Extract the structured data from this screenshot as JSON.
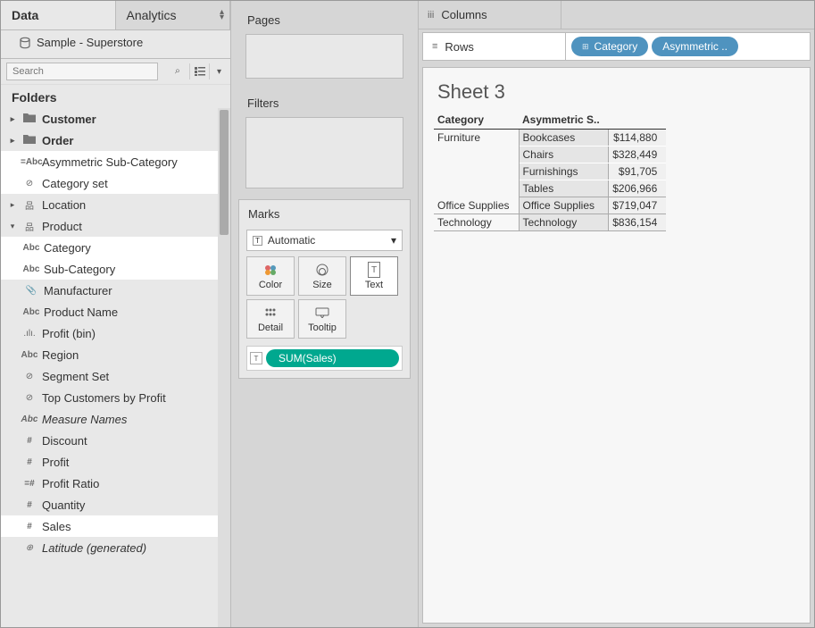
{
  "tabs": {
    "data": "Data",
    "analytics": "Analytics"
  },
  "datasource": "Sample - Superstore",
  "search": {
    "placeholder": "Search"
  },
  "folders_header": "Folders",
  "tree": {
    "customer": "Customer",
    "order": "Order",
    "asym_subcat": "Asymmetric Sub-Category",
    "category_set": "Category set",
    "location": "Location",
    "product": "Product",
    "category": "Category",
    "sub_category": "Sub-Category",
    "manufacturer": "Manufacturer",
    "product_name": "Product Name",
    "profit_bin": "Profit (bin)",
    "region": "Region",
    "segment_set": "Segment Set",
    "top_customers": "Top Customers by Profit",
    "measure_names": "Measure Names",
    "discount": "Discount",
    "profit": "Profit",
    "profit_ratio": "Profit Ratio",
    "quantity": "Quantity",
    "sales": "Sales",
    "latitude": "Latitude (generated)"
  },
  "shelves": {
    "pages": "Pages",
    "filters": "Filters",
    "columns": "Columns",
    "rows": "Rows"
  },
  "marks": {
    "title": "Marks",
    "type": "Automatic",
    "color": "Color",
    "size": "Size",
    "text": "Text",
    "detail": "Detail",
    "tooltip": "Tooltip",
    "pill": "SUM(Sales)"
  },
  "row_pills": {
    "category": "Category",
    "asym": "Asymmetric .."
  },
  "sheet": {
    "title": "Sheet 3"
  },
  "table": {
    "headers": {
      "category": "Category",
      "sub": "Asymmetric S.."
    },
    "rows": [
      {
        "cat": "Furniture",
        "sub": "Bookcases",
        "val": "$114,880"
      },
      {
        "cat": "",
        "sub": "Chairs",
        "val": "$328,449"
      },
      {
        "cat": "",
        "sub": "Furnishings",
        "val": "$91,705"
      },
      {
        "cat": "",
        "sub": "Tables",
        "val": "$206,966"
      },
      {
        "cat": "Office Supplies",
        "sub": "Office Supplies",
        "val": "$719,047"
      },
      {
        "cat": "Technology",
        "sub": "Technology",
        "val": "$836,154"
      }
    ]
  }
}
